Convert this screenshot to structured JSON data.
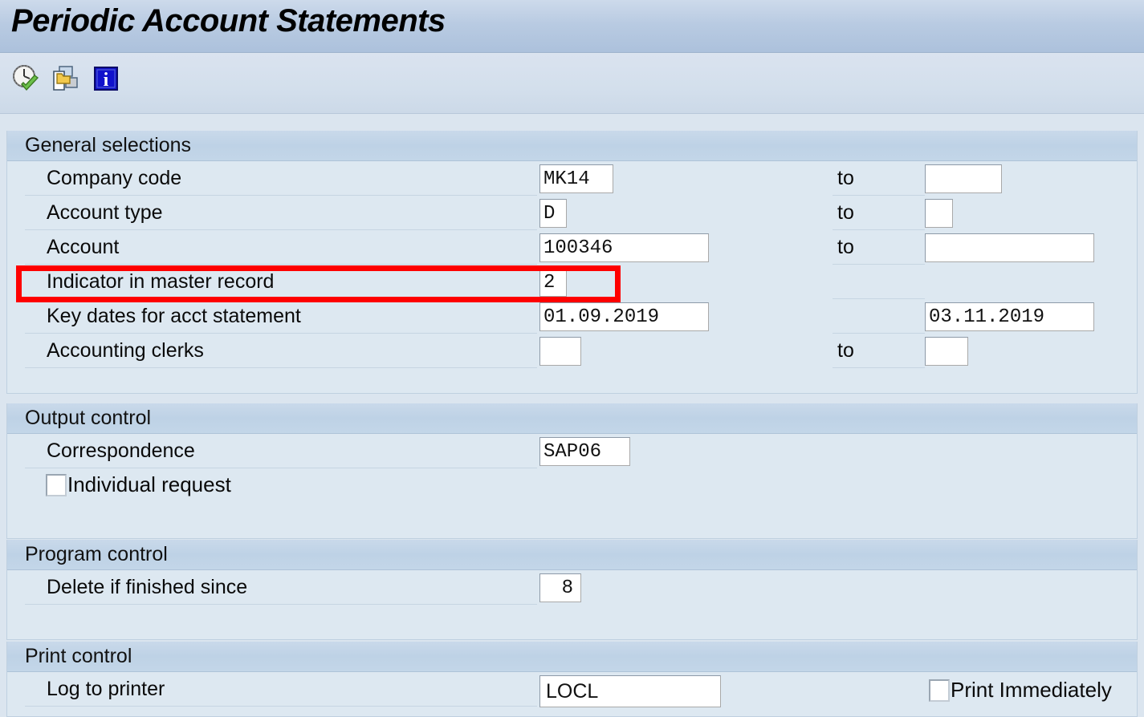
{
  "window": {
    "title": "Periodic Account Statements"
  },
  "toolbar": {
    "buttons": [
      {
        "name": "execute-icon",
        "tooltip": "Execute"
      },
      {
        "name": "multiple-selection-icon",
        "tooltip": "Multiple selection"
      },
      {
        "name": "information-icon",
        "tooltip": "Information"
      }
    ]
  },
  "sections": {
    "general_selections": {
      "title": "General selections",
      "rows": [
        {
          "label": "Company code",
          "value": "MK14",
          "to_label": "to",
          "to_value": ""
        },
        {
          "label": "Account type",
          "value": "D",
          "to_label": "to",
          "to_value": ""
        },
        {
          "label": "Account",
          "value": "100346",
          "to_label": "to",
          "to_value": ""
        },
        {
          "label": "Indicator in master record",
          "value": "2",
          "to_label": "",
          "to_value": ""
        },
        {
          "label": "Key dates for acct statement",
          "value": "01.09.2019",
          "to_label": "",
          "to_value": "03.11.2019"
        },
        {
          "label": "Accounting clerks",
          "value": "",
          "to_label": "to",
          "to_value": ""
        }
      ]
    },
    "output_control": {
      "title": "Output control",
      "correspondence_label": "Correspondence",
      "correspondence_value": "SAP06",
      "individual_request_label": "Individual request",
      "individual_request_checked": false
    },
    "program_control": {
      "title": "Program control",
      "delete_label": "Delete if finished since",
      "delete_value": "8"
    },
    "print_control": {
      "title": "Print control",
      "printer_label": "Log to printer",
      "printer_value": "LOCL",
      "print_immediately_label": "Print Immediately",
      "print_immediately_checked": false
    }
  },
  "annotation": {
    "highlight_color": "#fe0000",
    "highlight_target": "Indicator in master record"
  }
}
